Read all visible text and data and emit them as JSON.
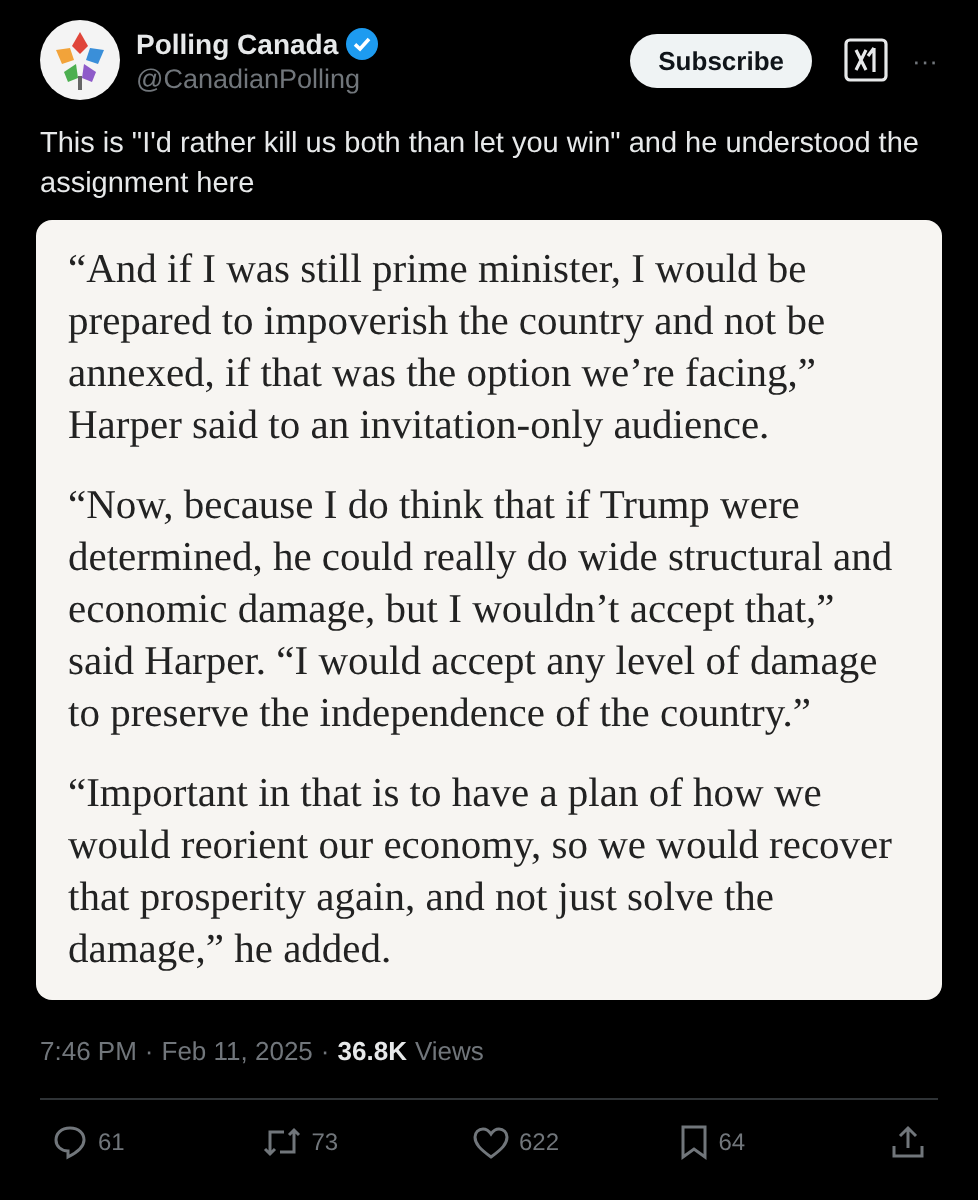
{
  "author": {
    "name": "Polling Canada",
    "verified": true,
    "handle": "@CanadianPolling"
  },
  "subscribe_button": "Subscribe",
  "more_button": "···",
  "text": "This is \"I'd rather kill us both than let you win\" and he understood the assignment here",
  "quote_image": {
    "paragraphs": [
      "“And if I was still prime minister, I would be prepared to impoverish the country and not be annexed, if that was the option we’re facing,” Harper said to an invitation-only audience.",
      "“Now, because I do think that if Trump were determined, he could really do wide structural and economic damage, but I wouldn’t accept that,” said Harper. “I would accept any level of damage to preserve the independence of the country.”",
      "“Important in that is to have a plan of how we would reorient our economy, so we would recover that prosperity again, and not just solve the damage,” he added."
    ]
  },
  "meta": {
    "time": "7:46 PM",
    "separator_1": "·",
    "date": "Feb 11, 2025",
    "separator_2": "·",
    "views_count": "36.8K",
    "views_label": "Views"
  },
  "actions": [
    {
      "kind": "reply",
      "count": "61"
    },
    {
      "kind": "repost",
      "count": "73"
    },
    {
      "kind": "like",
      "count": "622"
    },
    {
      "kind": "bookmark",
      "count": "64"
    },
    {
      "kind": "share"
    }
  ]
}
